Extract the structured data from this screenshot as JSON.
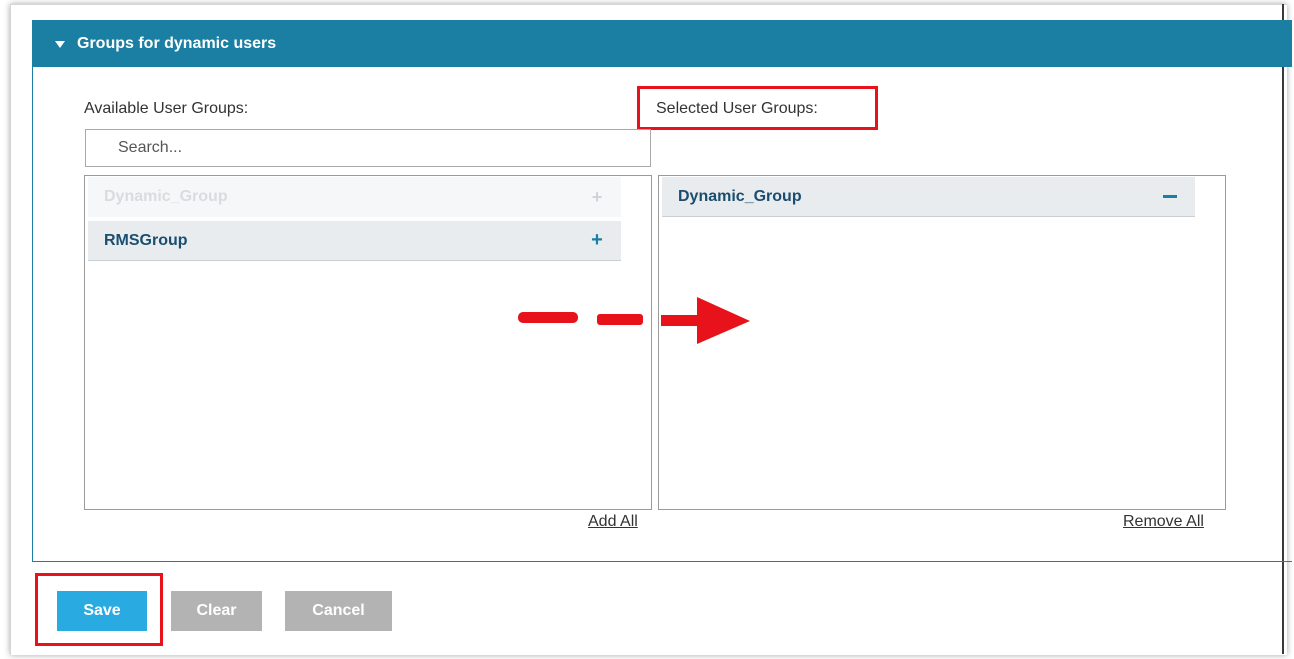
{
  "panel": {
    "title": "Groups for dynamic users"
  },
  "available": {
    "label": "Available User Groups:",
    "search_placeholder": "Search...",
    "items": [
      {
        "name": "Dynamic_Group",
        "action": "+",
        "state": "disabled"
      },
      {
        "name": "RMSGroup",
        "action": "+",
        "state": "enabled"
      }
    ],
    "add_all": "Add All"
  },
  "selected": {
    "label": "Selected User Groups:",
    "items": [
      {
        "name": "Dynamic_Group",
        "action": "minus"
      }
    ],
    "remove_all": "Remove All"
  },
  "buttons": {
    "save": "Save",
    "clear": "Clear",
    "cancel": "Cancel"
  },
  "colors": {
    "header": "#1a7fa3",
    "save": "#29abe2",
    "secondary": "#b3b3b3",
    "annotation": "#e8121b"
  }
}
